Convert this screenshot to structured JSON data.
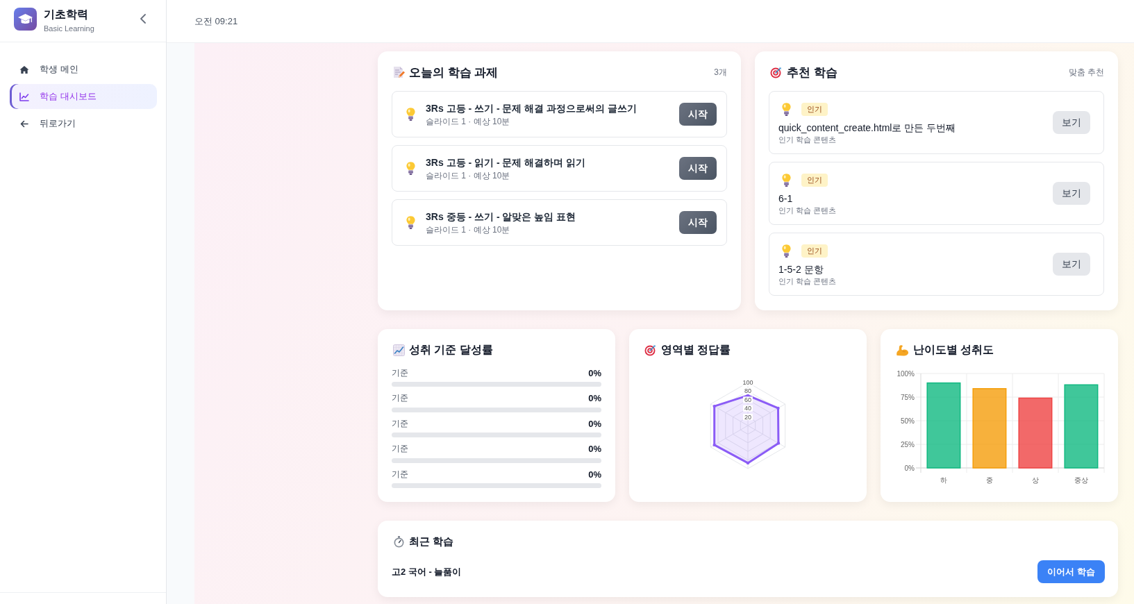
{
  "sidebar": {
    "brand": {
      "title": "기초학력",
      "subtitle": "Basic Learning"
    },
    "items": [
      {
        "label": "학생 메인",
        "selected": false
      },
      {
        "label": "학습 대시보드",
        "selected": true
      },
      {
        "label": "뒤로가기",
        "selected": false
      }
    ]
  },
  "header": {
    "time": "오전 09:21"
  },
  "today_tasks": {
    "title": "오늘의 학습 과제",
    "count": "3개",
    "items": [
      {
        "title": "3Rs 고등 - 쓰기 - 문제 해결 과정으로써의 글쓰기",
        "meta": "슬라이드 1 · 예상 10분",
        "button": "시작"
      },
      {
        "title": "3Rs 고등 - 읽기 - 문제 해결하며 읽기",
        "meta": "슬라이드 1 · 예상 10분",
        "button": "시작"
      },
      {
        "title": "3Rs 중등 - 쓰기 - 알맞은 높임 표현",
        "meta": "슬라이드 1 · 예상 10분",
        "button": "시작"
      }
    ]
  },
  "recommended": {
    "title": "추천 학습",
    "note": "맞춤 추천",
    "items": [
      {
        "badge": "인기",
        "title": "quick_content_create.html로 만든 두번째",
        "meta": "인기 학습 콘텐츠",
        "button": "보기"
      },
      {
        "badge": "인기",
        "title": "6-1",
        "meta": "인기 학습 콘텐츠",
        "button": "보기"
      },
      {
        "badge": "인기",
        "title": "1-5-2 문항",
        "meta": "인기 학습 콘텐츠",
        "button": "보기"
      }
    ]
  },
  "achievement": {
    "title": "성취 기준 달성률",
    "rows": [
      {
        "label": "기준",
        "reading": "0%",
        "level": 0
      },
      {
        "label": "기준",
        "reading": "0%",
        "level": 0
      },
      {
        "label": "기준",
        "reading": "0%",
        "level": 0
      },
      {
        "label": "기준",
        "reading": "0%",
        "level": 0
      },
      {
        "label": "기준",
        "reading": "0%",
        "level": 0
      }
    ]
  },
  "accuracy_by_area": {
    "title": "영역별 정답률",
    "scale_labels": [
      "100",
      "80",
      "60",
      "40",
      "20"
    ]
  },
  "difficulty": {
    "title": "난이도별 성취도",
    "chart_data": {
      "type": "bar",
      "categories": [
        "하",
        "중",
        "상",
        "중상"
      ],
      "values": [
        90,
        84,
        74,
        88
      ],
      "colors": [
        "#10b981",
        "#f59e0b",
        "#ef4444",
        "#10b981"
      ],
      "ylim": [
        0,
        100
      ],
      "grid": true,
      "yticks": [
        {
          "value": 0,
          "label": "0%"
        },
        {
          "value": 25,
          "label": "25%"
        },
        {
          "value": 50,
          "label": "50%"
        },
        {
          "value": 75,
          "label": "75%"
        },
        {
          "value": 100,
          "label": "100%"
        }
      ]
    }
  },
  "recent": {
    "title": "최근 학습",
    "item": "고2 국어 - 늘품이",
    "button": "이어서 학습"
  }
}
